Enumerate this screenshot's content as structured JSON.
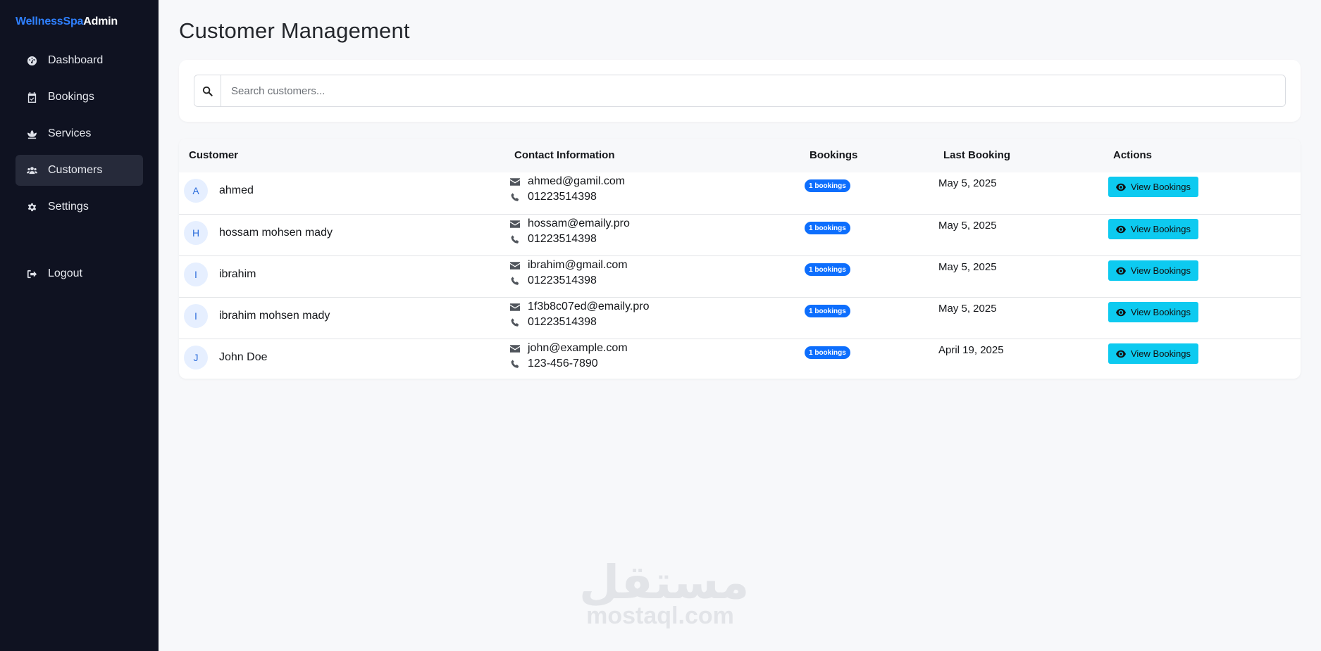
{
  "brand": {
    "part1": "WellnessSpa",
    "part2": "Admin"
  },
  "sidebar": {
    "items": [
      {
        "label": "Dashboard",
        "icon": "dashboard-icon",
        "active": false
      },
      {
        "label": "Bookings",
        "icon": "calendar-check-icon",
        "active": false
      },
      {
        "label": "Services",
        "icon": "lotus-icon",
        "active": false
      },
      {
        "label": "Customers",
        "icon": "users-icon",
        "active": true
      },
      {
        "label": "Settings",
        "icon": "gear-icon",
        "active": false
      }
    ],
    "logout": {
      "label": "Logout",
      "icon": "logout-icon"
    }
  },
  "page": {
    "title": "Customer Management"
  },
  "search": {
    "placeholder": "Search customers...",
    "value": ""
  },
  "table": {
    "headers": {
      "customer": "Customer",
      "contact": "Contact Information",
      "bookings": "Bookings",
      "last_booking": "Last Booking",
      "actions": "Actions"
    },
    "rows": [
      {
        "initial": "A",
        "name": "ahmed",
        "email": "ahmed@gamil.com",
        "phone": "01223514398",
        "bookings": "1 bookings",
        "last_booking": "May 5, 2025",
        "action": "View Bookings"
      },
      {
        "initial": "H",
        "name": "hossam mohsen mady",
        "email": "hossam@emaily.pro",
        "phone": "01223514398",
        "bookings": "1 bookings",
        "last_booking": "May 5, 2025",
        "action": "View Bookings"
      },
      {
        "initial": "I",
        "name": "ibrahim",
        "email": "ibrahim@gmail.com",
        "phone": "01223514398",
        "bookings": "1 bookings",
        "last_booking": "May 5, 2025",
        "action": "View Bookings"
      },
      {
        "initial": "I",
        "name": "ibrahim mohsen mady",
        "email": "1f3b8c07ed@emaily.pro",
        "phone": "01223514398",
        "bookings": "1 bookings",
        "last_booking": "May 5, 2025",
        "action": "View Bookings"
      },
      {
        "initial": "J",
        "name": "John Doe",
        "email": "john@example.com",
        "phone": "123-456-7890",
        "bookings": "1 bookings",
        "last_booking": "April 19, 2025",
        "action": "View Bookings"
      }
    ]
  },
  "watermark": {
    "arabic": "مستقل",
    "latin": "mostaql.com"
  },
  "colors": {
    "sidebar_bg": "#0f1221",
    "brand_accent": "#2f80ff",
    "badge": "#0d6efd",
    "action_button": "#0dcaf0",
    "page_bg": "#f7f8fa"
  }
}
